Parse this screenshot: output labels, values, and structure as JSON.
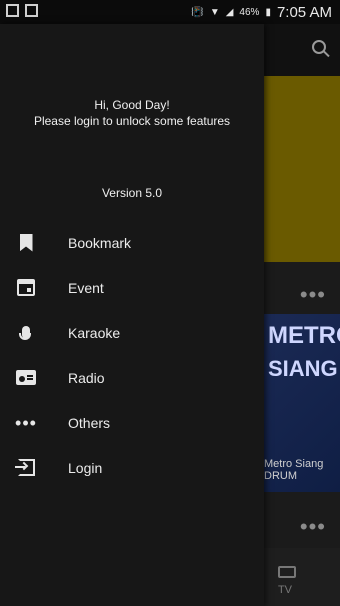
{
  "status_bar": {
    "battery_percent": "46%",
    "time": "7:05 AM"
  },
  "drawer": {
    "greeting": "Hi, Good Day!",
    "greeting_sub": "Please login to unlock some features",
    "version": "Version 5.0",
    "items": [
      {
        "label": "Bookmark",
        "icon": "bookmark-icon"
      },
      {
        "label": "Event",
        "icon": "calendar-icon"
      },
      {
        "label": "Karaoke",
        "icon": "microphone-icon"
      },
      {
        "label": "Radio",
        "icon": "radio-icon"
      },
      {
        "label": "Others",
        "icon": "more-horizontal-icon"
      },
      {
        "label": "Login",
        "icon": "login-icon"
      }
    ]
  },
  "background": {
    "card_title_1": "METRO",
    "card_title_2": "SIANG",
    "card_caption": "Metro Siang",
    "card_caption2": "DRUM",
    "bottom_nav_label": "TV",
    "accent_colors": {
      "banner": "#6a5a00",
      "card": "#1b2a55"
    }
  }
}
